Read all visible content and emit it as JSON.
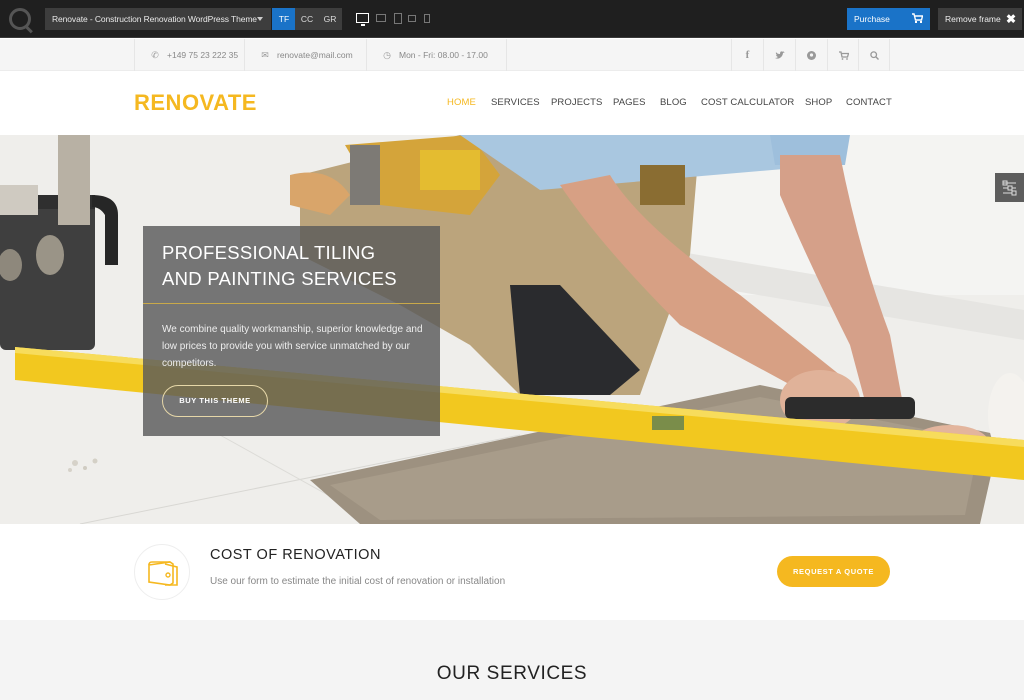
{
  "frame_bar": {
    "theme_select": "Renovate - Construction Renovation WordPress Theme",
    "marketplace_tabs": [
      {
        "label": "TF",
        "active": true
      },
      {
        "label": "CC",
        "active": false
      },
      {
        "label": "GR",
        "active": false
      }
    ],
    "devices": [
      "desktop",
      "laptop",
      "tablet-portrait",
      "tablet-landscape",
      "phone"
    ],
    "active_device": "desktop",
    "purchase_label": "Purchase",
    "remove_frame_label": "Remove frame",
    "accent_color": "#1a73c8"
  },
  "topbar": {
    "phone": "+149 75 23 222 35",
    "email": "renovate@mail.com",
    "hours": "Mon - Fri: 08.00 - 17.00",
    "icons": [
      "facebook-icon",
      "twitter-icon",
      "pinterest-icon",
      "cart-icon",
      "search-icon"
    ]
  },
  "header": {
    "logo": "RENOVATE",
    "brand_color": "#f5b820",
    "nav": [
      {
        "label": "HOME",
        "active": true
      },
      {
        "label": "SERVICES",
        "active": false
      },
      {
        "label": "PROJECTS",
        "active": false
      },
      {
        "label": "PAGES",
        "active": false
      },
      {
        "label": "BLOG",
        "active": false
      },
      {
        "label": "COST CALCULATOR",
        "active": false
      },
      {
        "label": "SHOP",
        "active": false
      },
      {
        "label": "CONTACT",
        "active": false
      }
    ]
  },
  "hero": {
    "title_line1": "PROFESSIONAL TILING",
    "title_line2": "AND PAINTING SERVICES",
    "text": "We combine quality workmanship, superior knowledge and low prices to provide you with service unmatched by our competitors.",
    "button": "BUY THIS THEME"
  },
  "cost": {
    "title": "COST OF RENOVATION",
    "text": "Use our form to estimate the initial cost of renovation or installation",
    "button": "REQUEST A QUOTE"
  },
  "services": {
    "title": "OUR SERVICES"
  }
}
